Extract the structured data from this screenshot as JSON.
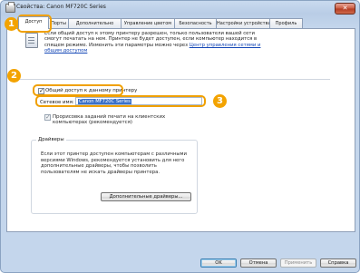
{
  "window": {
    "title": "Свойства: Canon MF720C Series"
  },
  "title_bar": {
    "close_label": "✕"
  },
  "tabs": [
    {
      "label": "Доступ"
    },
    {
      "label": "Порты"
    },
    {
      "label": "Дополнительно"
    },
    {
      "label": "Управление цветом"
    },
    {
      "label": "Безопасность"
    },
    {
      "label": "Настройки устройства"
    },
    {
      "label": "Профиль"
    }
  ],
  "active_tab": "Доступ",
  "sharing": {
    "info_text": "Если общий доступ к этому принтеру разрешен, только пользователи вашей сети смогут печатать на нем. Принтер не будет доступен, если компьютер находится в спящем режиме. Изменить эти параметры можно через",
    "info_link": "Центр управления сетями и общим доступом",
    "share_checkbox_label": "Общий доступ к данному принтеру",
    "share_checked": true,
    "network_name_label": "Сетевое имя:",
    "network_name_value": "Canon MF720C Series",
    "render_jobs_label": "Прорисовка заданий печати на клиентских компьютерах (рекомендуется)",
    "render_jobs_checked": true
  },
  "drivers": {
    "group_title": "Драйверы",
    "description": "Если этот принтер доступен компьютерам с различными версиями Windows, рекомендуется установить для него дополнительные драйверы, чтобы позволить пользователям не искать драйверы принтера.",
    "additional_drivers_button": "Дополнительные драйверы..."
  },
  "buttons": {
    "ok": "OK",
    "cancel": "Отмена",
    "apply": "Применить",
    "help": "Справка"
  },
  "callouts": [
    "1",
    "2",
    "3"
  ],
  "colors": {
    "callout": "#f3a300",
    "link": "#1346b6",
    "selection": "#3a70c8"
  }
}
